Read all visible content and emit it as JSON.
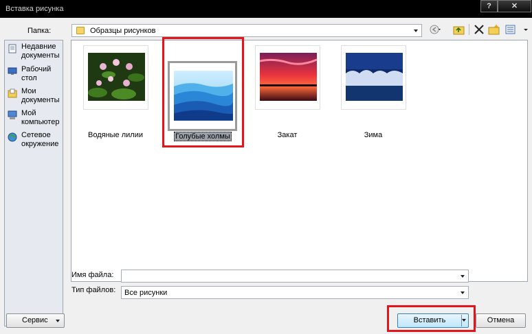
{
  "window": {
    "title": "Вставка рисунка",
    "help_label": "?",
    "close_label": "✕"
  },
  "folder_label": "Папка:",
  "folder_value": "Образцы рисунков",
  "places": [
    {
      "label": "Недавние документы"
    },
    {
      "label": "Рабочий стол"
    },
    {
      "label": "Мои документы"
    },
    {
      "label": "Мой компьютер"
    },
    {
      "label": "Сетевое окружение"
    }
  ],
  "files": [
    {
      "name": "Водяные лилии"
    },
    {
      "name": "Голубые холмы"
    },
    {
      "name": "Закат"
    },
    {
      "name": "Зима"
    }
  ],
  "filename_label": "Имя файла:",
  "filename_value": "",
  "filetype_label": "Тип файлов:",
  "filetype_value": "Все рисунки",
  "buttons": {
    "service": "Сервис",
    "insert": "Вставить",
    "cancel": "Отмена"
  },
  "icons": [
    "back-icon",
    "up-folder-icon",
    "delete-icon",
    "new-folder-icon",
    "views-icon"
  ]
}
